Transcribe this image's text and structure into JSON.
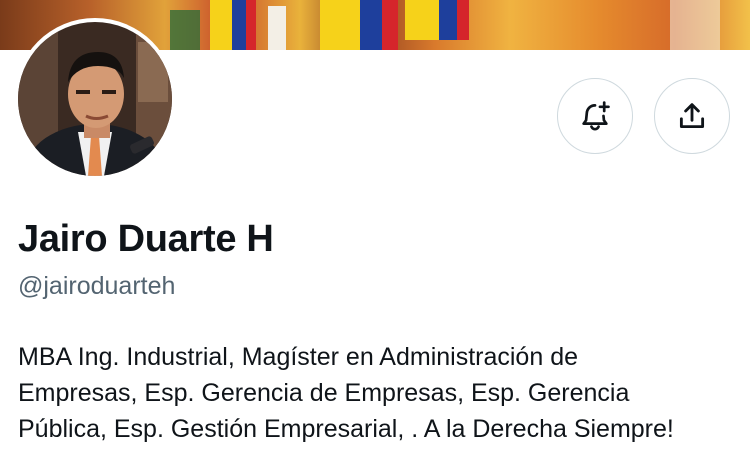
{
  "profile": {
    "display_name": "Jairo Duarte H",
    "handle": "@jairoduarteh",
    "bio_lines": [
      "MBA Ing. Industrial, Magíster en Administración de",
      "Empresas, Esp. Gerencia de Empresas, Esp. Gerencia",
      "Pública, Esp. Gestión Empresarial, . A la Derecha Siempre!"
    ]
  },
  "actions": {
    "notify_icon": "bell-plus-icon",
    "share_icon": "share-upload-icon"
  },
  "colors": {
    "text_primary": "#0f1419",
    "text_secondary": "#536471",
    "border": "#cfd9de",
    "background": "#ffffff"
  }
}
